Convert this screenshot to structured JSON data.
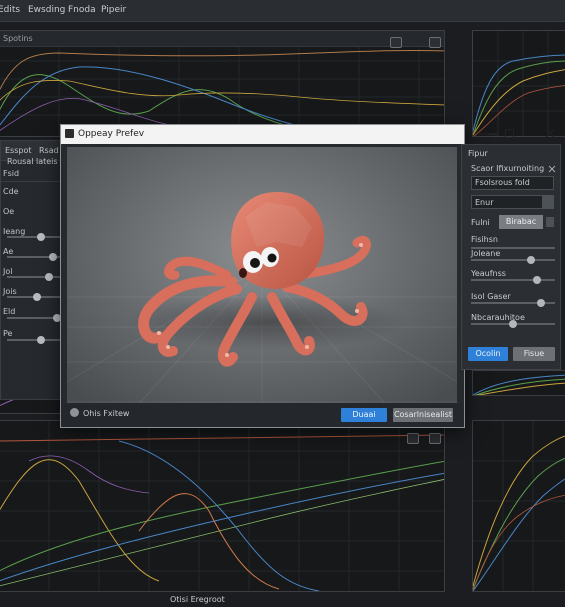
{
  "menu": {
    "items": [
      {
        "label": "Edits"
      },
      {
        "label": "Ewsding"
      },
      {
        "label": "Fnoda"
      },
      {
        "label": "Pipeir"
      }
    ]
  },
  "graphs": {
    "top_left_header": "Spotins"
  },
  "left_panel": {
    "tabs": [
      "Esspot",
      "Rsad"
    ],
    "header_lines": [
      "Rousal lateis",
      "Fsid"
    ],
    "labels": [
      "Cde",
      "Oe",
      "Ieang",
      "Ae",
      "Jol",
      "Jois",
      "Eld",
      "Pe"
    ]
  },
  "preview": {
    "title": "Oppeay Prefev",
    "footer_label": "Ohis Fxitew",
    "primary_button": "Duaai",
    "secondary_button": "Cosarlnisealist"
  },
  "right_panel": {
    "title": "Fipur",
    "name_label": "Scaor Ifixurnoiting",
    "name_value": "Fsolsrous fold",
    "section_label": "Enur",
    "mode_label": "Fulni",
    "mode_value": "Birabac",
    "rows": [
      {
        "label": "Fisihsn"
      },
      {
        "label": "Joleane"
      },
      {
        "label": "Yeaufnss"
      },
      {
        "label": "Isol Gaser"
      },
      {
        "label": "Nbcarauhitoe"
      }
    ],
    "primary_button": "Ocolin",
    "secondary_button": "Fisue"
  },
  "bottom_status": "Otisi Eregroot",
  "colors": {
    "accent_blue": "#2f80d9",
    "octopus": "#d86e5c",
    "panel_bg": "#26292d"
  }
}
